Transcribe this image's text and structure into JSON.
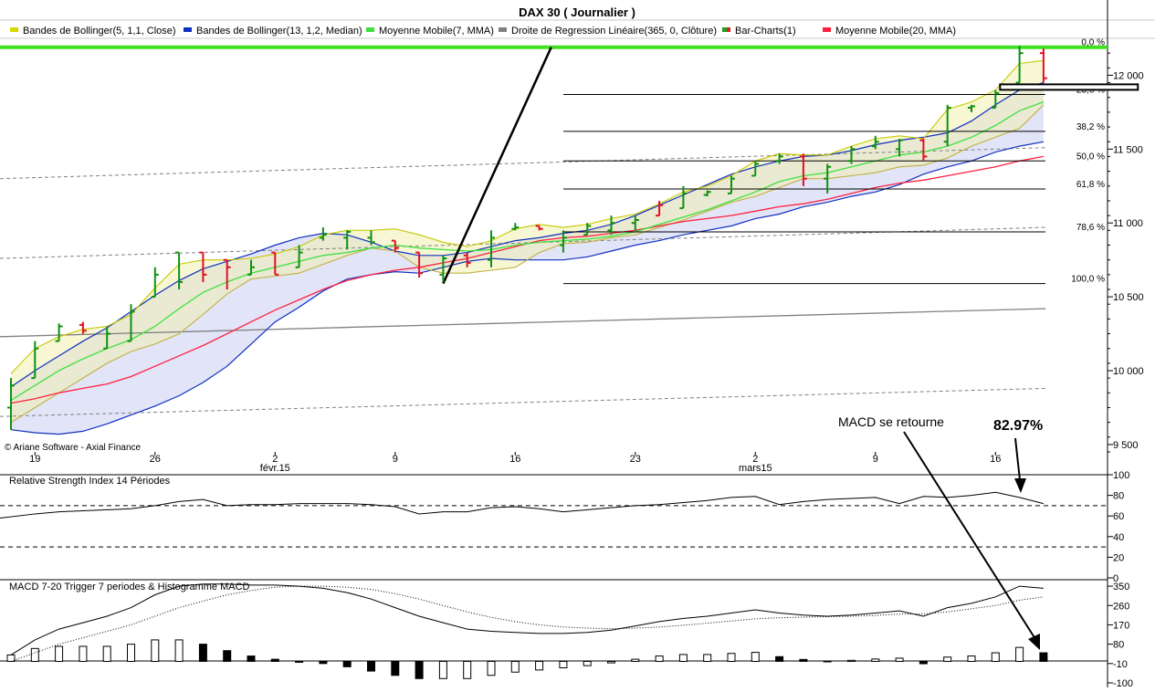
{
  "chart_data": {
    "type": "line",
    "title": "DAX 30  ( Journalier )",
    "copyright": "© Ariane Software - Axial Finance",
    "legend": [
      {
        "name": "Bandes de Bollinger(5, 1,1, Close)",
        "color": "#d8d800"
      },
      {
        "name": "Bandes de Bollinger(13, 1,2, Median)",
        "color": "#1030c0"
      },
      {
        "name": "Moyenne Mobile(7, MMA)",
        "color": "#40e040"
      },
      {
        "name": "Droite de Regression Linéaire(365, 0, Clôture)",
        "color": "#808080"
      },
      {
        "name": "Bar-Charts(1)",
        "color": "#20a020"
      },
      {
        "name": "Moyenne Mobile(20, MMA)",
        "color": "#ff2040"
      }
    ],
    "x_ticks": [
      {
        "label": "19",
        "i": 1
      },
      {
        "label": "26",
        "i": 6
      },
      {
        "label": "2",
        "i": 11
      },
      {
        "label": "9",
        "i": 16
      },
      {
        "label": "16",
        "i": 21
      },
      {
        "label": "23",
        "i": 26
      },
      {
        "label": "2",
        "i": 31
      },
      {
        "label": "9",
        "i": 36
      },
      {
        "label": "16",
        "i": 41
      }
    ],
    "month_labels": [
      {
        "label": "févr.15",
        "i": 11
      },
      {
        "label": "mars15",
        "i": 31
      }
    ],
    "price": {
      "ylim": [
        9450,
        12250
      ],
      "yticks": [
        9500,
        10000,
        10500,
        11000,
        11500,
        12000
      ],
      "ytick_labels": [
        "9 500",
        "10 000",
        "10 500",
        "11 000",
        "11 500",
        "12 000"
      ],
      "bars": [
        {
          "o": 9750,
          "h": 9950,
          "l": 9600,
          "c": 9900,
          "up": true
        },
        {
          "o": 9950,
          "h": 10200,
          "l": 9950,
          "c": 10150,
          "up": true
        },
        {
          "o": 10200,
          "h": 10320,
          "l": 10200,
          "c": 10300,
          "up": true
        },
        {
          "o": 10310,
          "h": 10330,
          "l": 10250,
          "c": 10270,
          "up": false
        },
        {
          "o": 10150,
          "h": 10300,
          "l": 10150,
          "c": 10250,
          "up": true
        },
        {
          "o": 10200,
          "h": 10450,
          "l": 10200,
          "c": 10400,
          "up": true
        },
        {
          "o": 10500,
          "h": 10700,
          "l": 10500,
          "c": 10650,
          "up": true
        },
        {
          "o": 10800,
          "h": 10800,
          "l": 10550,
          "c": 10600,
          "up": true
        },
        {
          "o": 10800,
          "h": 10800,
          "l": 10600,
          "c": 10650,
          "up": false
        },
        {
          "o": 10750,
          "h": 10750,
          "l": 10550,
          "c": 10700,
          "up": false
        },
        {
          "o": 10650,
          "h": 10750,
          "l": 10650,
          "c": 10700,
          "up": true
        },
        {
          "o": 10800,
          "h": 10800,
          "l": 10650,
          "c": 10650,
          "up": false
        },
        {
          "o": 10700,
          "h": 10850,
          "l": 10700,
          "c": 10800,
          "up": true
        },
        {
          "o": 10900,
          "h": 10970,
          "l": 10880,
          "c": 10920,
          "up": true
        },
        {
          "o": 10900,
          "h": 10950,
          "l": 10820,
          "c": 10940,
          "up": true
        },
        {
          "o": 10900,
          "h": 10950,
          "l": 10850,
          "c": 10870,
          "up": true
        },
        {
          "o": 10880,
          "h": 10880,
          "l": 10800,
          "c": 10830,
          "up": false
        },
        {
          "o": 10800,
          "h": 10800,
          "l": 10630,
          "c": 10660,
          "up": false
        },
        {
          "o": 10650,
          "h": 10780,
          "l": 10600,
          "c": 10760,
          "up": true
        },
        {
          "o": 10780,
          "h": 10800,
          "l": 10700,
          "c": 10730,
          "up": false
        },
        {
          "o": 10750,
          "h": 10950,
          "l": 10700,
          "c": 10900,
          "up": true
        },
        {
          "o": 10960,
          "h": 11000,
          "l": 10950,
          "c": 10970,
          "up": true
        },
        {
          "o": 10980,
          "h": 10980,
          "l": 10950,
          "c": 10960,
          "up": false
        },
        {
          "o": 10850,
          "h": 10950,
          "l": 10800,
          "c": 10900,
          "up": true
        },
        {
          "o": 10920,
          "h": 11000,
          "l": 10920,
          "c": 10980,
          "up": true
        },
        {
          "o": 10950,
          "h": 11050,
          "l": 10920,
          "c": 11000,
          "up": true
        },
        {
          "o": 11000,
          "h": 11050,
          "l": 10950,
          "c": 11020,
          "up": true
        },
        {
          "o": 11050,
          "h": 11150,
          "l": 11050,
          "c": 11120,
          "up": false
        },
        {
          "o": 11100,
          "h": 11250,
          "l": 11100,
          "c": 11200,
          "up": true
        },
        {
          "o": 11190,
          "h": 11220,
          "l": 11180,
          "c": 11210,
          "up": true
        },
        {
          "o": 11200,
          "h": 11320,
          "l": 11200,
          "c": 11300,
          "up": true
        },
        {
          "o": 11320,
          "h": 11420,
          "l": 11320,
          "c": 11400,
          "up": true
        },
        {
          "o": 11420,
          "h": 11470,
          "l": 11400,
          "c": 11450,
          "up": true
        },
        {
          "o": 11450,
          "h": 11470,
          "l": 11250,
          "c": 11300,
          "up": false
        },
        {
          "o": 11300,
          "h": 11400,
          "l": 11200,
          "c": 11380,
          "up": true
        },
        {
          "o": 11420,
          "h": 11520,
          "l": 11400,
          "c": 11500,
          "up": true
        },
        {
          "o": 11520,
          "h": 11590,
          "l": 11500,
          "c": 11550,
          "up": true
        },
        {
          "o": 11500,
          "h": 11570,
          "l": 11450,
          "c": 11560,
          "up": true
        },
        {
          "o": 11560,
          "h": 11570,
          "l": 11420,
          "c": 11450,
          "up": false
        },
        {
          "o": 11550,
          "h": 11800,
          "l": 11520,
          "c": 11780,
          "up": true
        },
        {
          "o": 11780,
          "h": 11800,
          "l": 11750,
          "c": 11790,
          "up": true
        },
        {
          "o": 11780,
          "h": 11900,
          "l": 11780,
          "c": 11880,
          "up": true
        },
        {
          "o": 11950,
          "h": 12200,
          "l": 11950,
          "c": 12150,
          "up": true
        },
        {
          "o": 12150,
          "h": 12180,
          "l": 11950,
          "c": 11980,
          "up": false
        }
      ],
      "boll5_upper": [
        9980,
        10150,
        10230,
        10280,
        10300,
        10380,
        10560,
        10720,
        10750,
        10750,
        10760,
        10790,
        10840,
        10920,
        10950,
        10950,
        10960,
        10920,
        10870,
        10840,
        10880,
        10960,
        10990,
        10970,
        10990,
        11030,
        11060,
        11130,
        11210,
        11250,
        11320,
        11420,
        11470,
        11460,
        11460,
        11520,
        11570,
        11590,
        11570,
        11770,
        11820,
        11900,
        12080,
        12100
      ],
      "boll5_lower": [
        9650,
        9750,
        9850,
        9950,
        10050,
        10130,
        10180,
        10250,
        10380,
        10520,
        10620,
        10640,
        10660,
        10720,
        10780,
        10830,
        10810,
        10700,
        10660,
        10660,
        10680,
        10700,
        10800,
        10860,
        10870,
        10900,
        10920,
        10970,
        11020,
        11080,
        11140,
        11180,
        11240,
        11300,
        11300,
        11320,
        11340,
        11380,
        11390,
        11440,
        11520,
        11580,
        11640,
        11800
      ],
      "boll13_upper": [
        9890,
        10000,
        10100,
        10200,
        10290,
        10400,
        10510,
        10610,
        10690,
        10740,
        10790,
        10850,
        10900,
        10930,
        10920,
        10870,
        10810,
        10780,
        10780,
        10800,
        10840,
        10880,
        10900,
        10930,
        10950,
        10990,
        11050,
        11120,
        11190,
        11260,
        11330,
        11380,
        11420,
        11450,
        11460,
        11490,
        11530,
        11560,
        11580,
        11610,
        11690,
        11800,
        11900,
        11950
      ],
      "boll13_lower": [
        9600,
        9580,
        9570,
        9590,
        9640,
        9700,
        9760,
        9830,
        9920,
        10030,
        10180,
        10330,
        10430,
        10540,
        10620,
        10650,
        10670,
        10660,
        10700,
        10740,
        10760,
        10750,
        10750,
        10750,
        10770,
        10810,
        10850,
        10880,
        10920,
        10950,
        10980,
        11030,
        11060,
        11110,
        11140,
        11180,
        11210,
        11260,
        11330,
        11380,
        11420,
        11480,
        11520,
        11550
      ],
      "mm7": [
        9800,
        9900,
        10000,
        10080,
        10150,
        10210,
        10300,
        10420,
        10530,
        10600,
        10660,
        10700,
        10740,
        10780,
        10800,
        10830,
        10850,
        10830,
        10820,
        10810,
        10820,
        10850,
        10870,
        10880,
        10890,
        10910,
        10940,
        10990,
        11040,
        11090,
        11150,
        11210,
        11280,
        11320,
        11340,
        11380,
        11420,
        11460,
        11480,
        11520,
        11580,
        11660,
        11760,
        11820
      ],
      "mm20": [
        9780,
        9810,
        9850,
        9880,
        9910,
        9960,
        10030,
        10100,
        10170,
        10250,
        10330,
        10410,
        10480,
        10550,
        10610,
        10650,
        10680,
        10700,
        10730,
        10760,
        10800,
        10840,
        10880,
        10900,
        10910,
        10930,
        10950,
        10980,
        11010,
        11030,
        11050,
        11080,
        11110,
        11130,
        11160,
        11200,
        11240,
        11270,
        11290,
        11320,
        11350,
        11380,
        11420,
        11450
      ],
      "regression": {
        "y_start": 10230,
        "y_end": 10420
      },
      "regression_channel_upper": {
        "y_start": 10760,
        "y_end": 10970
      },
      "regression_channel_mid": {
        "y_start": 11300,
        "y_end": 11510
      },
      "regression_channel_lower": {
        "y_start": 9690,
        "y_end": 9880
      },
      "fibonacci": {
        "high": 12190,
        "low": 10590,
        "levels": [
          {
            "label": "0,0 %",
            "value": 12190
          },
          {
            "label": "23,6 %",
            "value": 11870
          },
          {
            "label": "38,2 %",
            "value": 11620
          },
          {
            "label": "50,0 %",
            "value": 11420
          },
          {
            "label": "61,8 %",
            "value": 11230
          },
          {
            "label": "78,6 %",
            "value": 10940
          },
          {
            "label": "100,0 %",
            "value": 10590
          }
        ]
      },
      "trendline": {
        "from": {
          "i": 18,
          "y": 10590
        },
        "to": {
          "i": 22.5,
          "y": 12190
        }
      },
      "resistance_box": {
        "from_i": 41,
        "to_i": 47.5,
        "y": 11920
      }
    },
    "rsi": {
      "title": "Relative Strength Index 14 Périodes",
      "ylim": [
        0,
        100
      ],
      "yticks": [
        0,
        20,
        40,
        60,
        80,
        100
      ],
      "levels": [
        30,
        70
      ],
      "values": [
        58,
        62,
        64,
        65,
        66,
        67,
        70,
        74,
        76,
        70,
        71,
        71,
        72,
        72,
        72,
        71,
        69,
        62,
        64,
        64,
        68,
        69,
        67,
        64,
        66,
        68,
        70,
        71,
        73,
        75,
        78,
        79,
        71,
        74,
        76,
        77,
        78,
        72,
        79,
        78,
        80,
        82.97,
        78,
        72
      ]
    },
    "macd": {
      "title": "MACD 7-20   Trigger 7 periodes & Histogramme MACD",
      "ylim": [
        -100,
        380
      ],
      "yticks": [
        -100,
        -10,
        80,
        170,
        260,
        350
      ],
      "ytick_labels": [
        "-100",
        "-10",
        "80",
        "170",
        "260",
        "350"
      ],
      "macd_line": [
        30,
        100,
        150,
        180,
        210,
        250,
        310,
        350,
        360,
        360,
        355,
        355,
        350,
        340,
        320,
        290,
        250,
        210,
        180,
        150,
        140,
        135,
        130,
        130,
        135,
        145,
        165,
        185,
        200,
        210,
        225,
        240,
        225,
        215,
        210,
        215,
        225,
        235,
        210,
        250,
        270,
        300,
        350,
        340
      ],
      "trigger_line": [
        0,
        40,
        80,
        110,
        140,
        170,
        210,
        250,
        280,
        310,
        330,
        345,
        350,
        350,
        345,
        335,
        315,
        290,
        260,
        230,
        205,
        185,
        170,
        160,
        155,
        152,
        155,
        160,
        168,
        178,
        188,
        198,
        203,
        206,
        208,
        210,
        214,
        220,
        221,
        230,
        245,
        260,
        285,
        300
      ],
      "histogram": [
        30,
        60,
        70,
        70,
        70,
        80,
        100,
        100,
        80,
        50,
        25,
        10,
        0,
        -10,
        -25,
        -45,
        -65,
        -80,
        -80,
        -80,
        -65,
        -50,
        -40,
        -30,
        -20,
        -7,
        10,
        25,
        32,
        32,
        37,
        42,
        22,
        9,
        2,
        5,
        11,
        15,
        -11,
        20,
        25,
        40,
        65,
        40
      ],
      "annotation": "MACD se retourne",
      "rsi_annotation": "82.97%"
    }
  }
}
